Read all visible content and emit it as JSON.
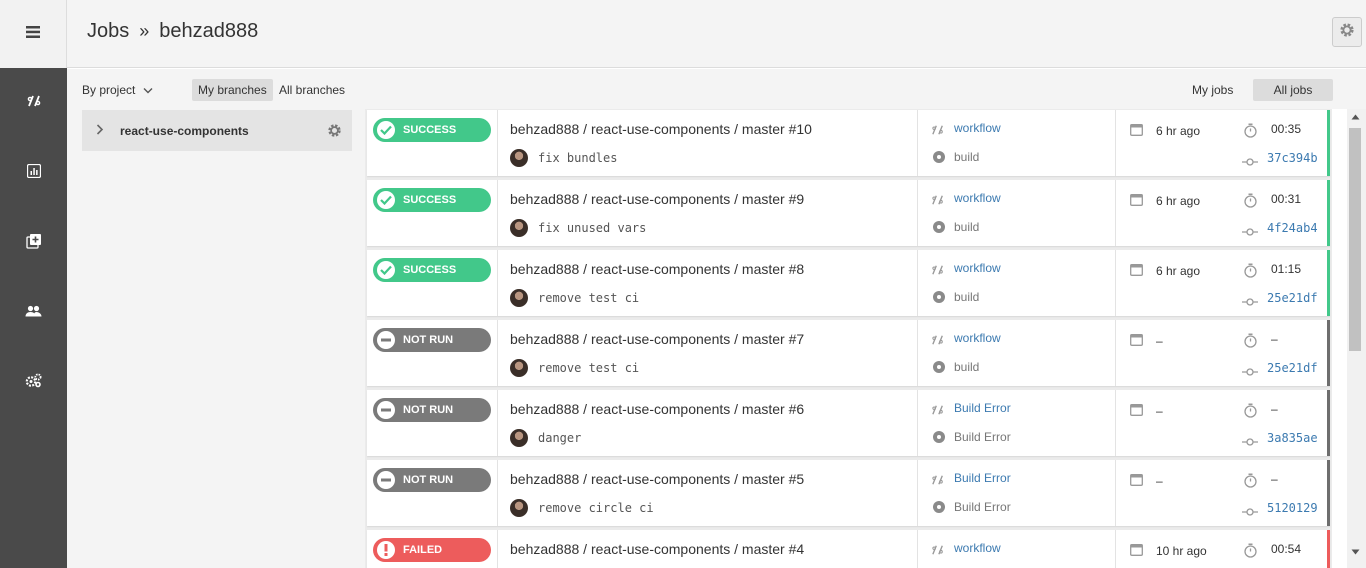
{
  "header": {
    "title": "Jobs",
    "separator": "»",
    "org": "behzad888"
  },
  "filters": {
    "by_project": "By project",
    "my_branches": "My branches",
    "all_branches": "All branches",
    "my_jobs": "My jobs",
    "all_jobs": "All jobs"
  },
  "project": {
    "name": "react-use-components"
  },
  "jobs": [
    {
      "status": "success",
      "status_label": "SUCCESS",
      "title": "behzad888 / react-use-components / master #10",
      "commit": "fix bundles",
      "workflow": "workflow",
      "job": "build",
      "when": "6 hr ago",
      "duration": "00:35",
      "sha": "37c394b"
    },
    {
      "status": "success",
      "status_label": "SUCCESS",
      "title": "behzad888 / react-use-components / master #9",
      "commit": "fix unused vars",
      "workflow": "workflow",
      "job": "build",
      "when": "6 hr ago",
      "duration": "00:31",
      "sha": "4f24ab4"
    },
    {
      "status": "success",
      "status_label": "SUCCESS",
      "title": "behzad888 / react-use-components / master #8",
      "commit": "remove test ci",
      "workflow": "workflow",
      "job": "build",
      "when": "6 hr ago",
      "duration": "01:15",
      "sha": "25e21df"
    },
    {
      "status": "notrun",
      "status_label": "NOT RUN",
      "title": "behzad888 / react-use-components / master #7",
      "commit": "remove test ci",
      "workflow": "workflow",
      "job": "build",
      "when": "–",
      "duration": "–",
      "sha": "25e21df"
    },
    {
      "status": "notrun",
      "status_label": "NOT RUN",
      "title": "behzad888 / react-use-components / master #6",
      "commit": "danger",
      "workflow": "Build Error",
      "job": "Build Error",
      "when": "–",
      "duration": "–",
      "sha": "3a835ae"
    },
    {
      "status": "notrun",
      "status_label": "NOT RUN",
      "title": "behzad888 / react-use-components / master #5",
      "commit": "remove circle ci",
      "workflow": "Build Error",
      "job": "Build Error",
      "when": "–",
      "duration": "–",
      "sha": "5120129"
    },
    {
      "status": "failed",
      "status_label": "FAILED",
      "title": "behzad888 / react-use-components / master #4",
      "commit": "",
      "workflow": "workflow",
      "job": "",
      "when": "10 hr ago",
      "duration": "00:54",
      "sha": ""
    }
  ],
  "icons": {
    "menu": "menu-icon",
    "workflows": "workflows-icon",
    "insights": "insights-icon",
    "add_projects": "add-projects-icon",
    "team": "team-icon",
    "settings": "settings-icon"
  },
  "colors": {
    "success": "#42c88a",
    "notrun": "#7a7a7a",
    "failed": "#ed5c5c",
    "link": "#3c7ab0"
  }
}
